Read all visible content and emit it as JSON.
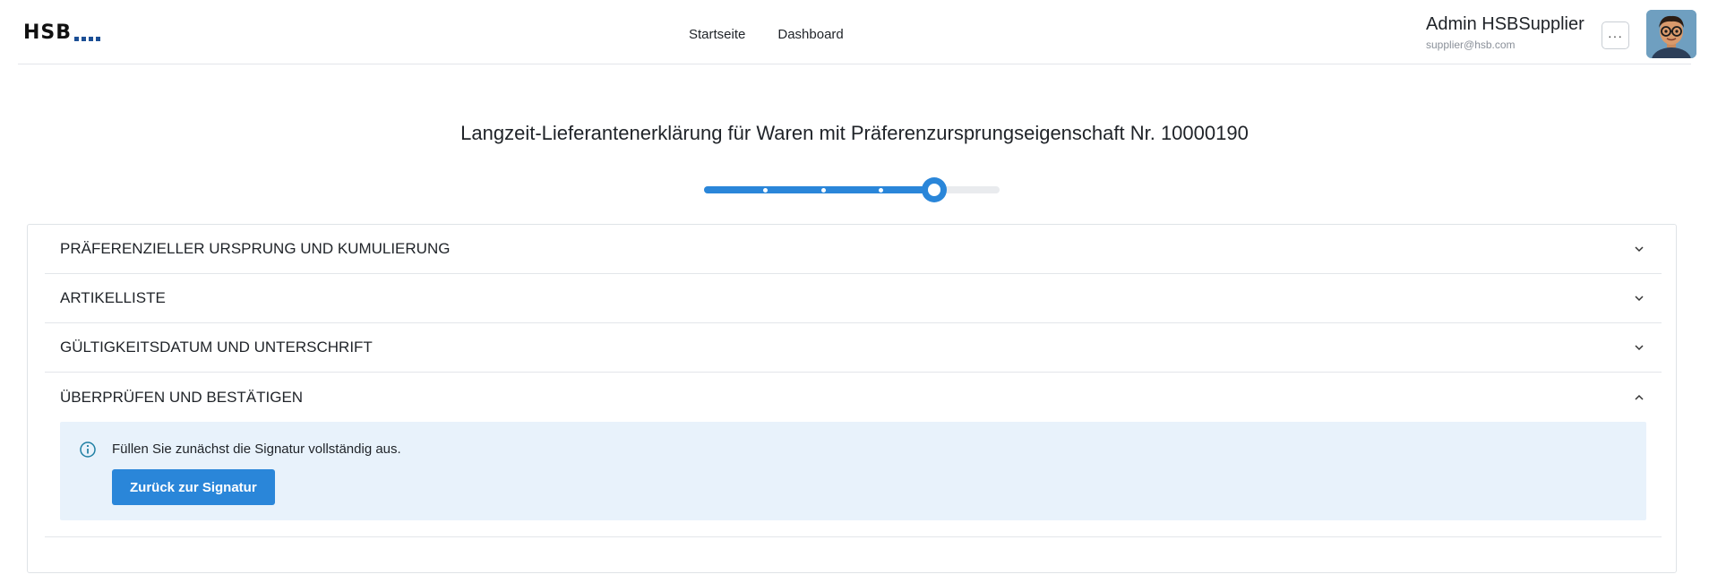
{
  "header": {
    "logo_text": "HSB",
    "nav": {
      "home_label": "Startseite",
      "dashboard_label": "Dashboard"
    },
    "user": {
      "name": "Admin HSBSupplier",
      "email": "supplier@hsb.com"
    },
    "more_label": "···"
  },
  "page": {
    "title": "Langzeit-Lieferantenerklärung für Waren mit Präferenzursprungseigenschaft Nr. 10000190"
  },
  "stepper": {
    "total_steps": 5,
    "current_step": 5,
    "progress_fraction": 0.78
  },
  "accordion": {
    "sections": [
      {
        "label": "PRÄFERENZIELLER URSPRUNG UND KUMULIERUNG",
        "expanded": false
      },
      {
        "label": "ARTIKELLISTE",
        "expanded": false
      },
      {
        "label": "GÜLTIGKEITSDATUM UND UNTERSCHRIFT",
        "expanded": false
      },
      {
        "label": "ÜBERPRÜFEN UND BESTÄTIGEN",
        "expanded": true
      }
    ],
    "review": {
      "info_text": "Füllen Sie zunächst die Signatur vollständig aus.",
      "button_label": "Zurück zur Signatur"
    }
  },
  "colors": {
    "accent": "#2a86d9",
    "info_background": "#e8f2fb",
    "logo_dots": "#1c4f95"
  }
}
